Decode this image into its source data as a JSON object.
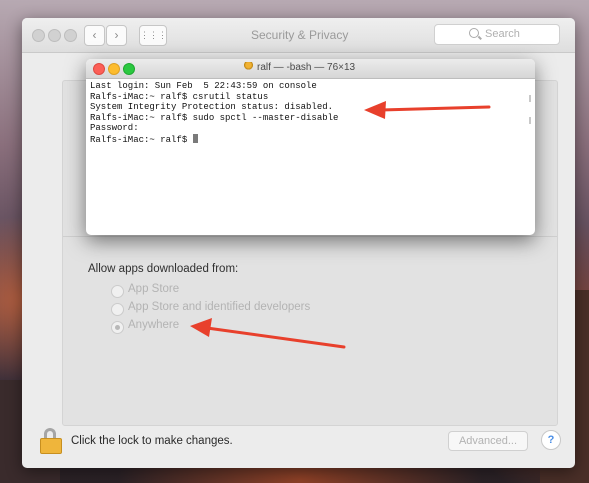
{
  "prefs": {
    "title": "Security & Privacy",
    "search_placeholder": "Search",
    "nav": {
      "back": "‹",
      "forward": "›",
      "grid": "⋮⋮⋮"
    },
    "allow_label": "Allow apps downloaded from:",
    "options": [
      {
        "label": "App Store",
        "selected": false
      },
      {
        "label": "App Store and identified developers",
        "selected": false
      },
      {
        "label": "Anywhere",
        "selected": true
      }
    ],
    "lock_text": "Click the lock to make changes.",
    "advanced_label": "Advanced...",
    "help_label": "?"
  },
  "terminal": {
    "title": "ralf — -bash — 76×13",
    "lines": [
      "Last login: Sun Feb  5 22:43:59 on console",
      "Ralfs-iMac:~ ralf$ csrutil status",
      "System Integrity Protection status: disabled.",
      "Ralfs-iMac:~ ralf$ sudo spctl --master-disable",
      "Password:",
      "Ralfs-iMac:~ ralf$ "
    ]
  },
  "colors": {
    "arrow": "#e8402c",
    "close": "#fc5f57",
    "minimize": "#fdbc2e",
    "zoom": "#2bc840",
    "lock": "#efb53b"
  }
}
